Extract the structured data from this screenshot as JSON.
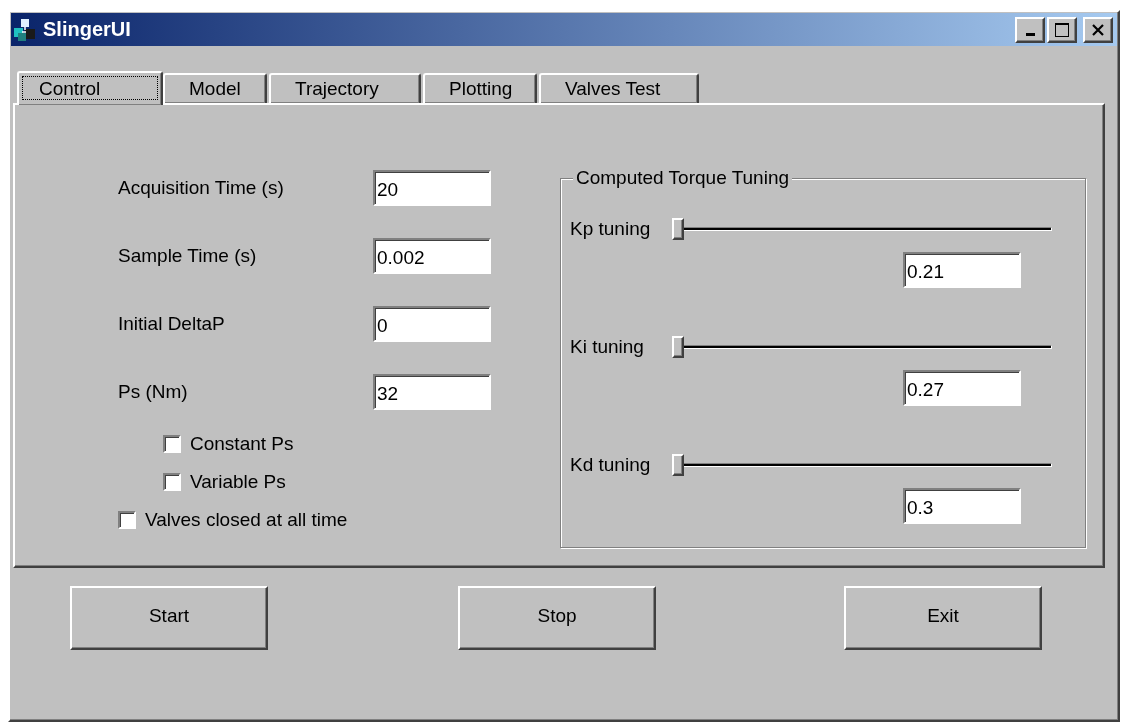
{
  "window": {
    "title": "SlingerUI",
    "controls": [
      {
        "kind": "minimize"
      },
      {
        "kind": "maximize"
      },
      {
        "kind": "close"
      }
    ]
  },
  "tabs": [
    {
      "label": "Control",
      "selected": true
    },
    {
      "label": "Model",
      "selected": false
    },
    {
      "label": "Trajectory",
      "selected": false
    },
    {
      "label": "Plotting",
      "selected": false
    },
    {
      "label": "Valves Test",
      "selected": false
    }
  ],
  "fields": [
    {
      "label": "Acquisition Time (s)",
      "value": "20"
    },
    {
      "label": "Sample Time (s)",
      "value": "0.002"
    },
    {
      "label": "Initial DeltaP",
      "value": "0"
    },
    {
      "label": "Ps (Nm)",
      "value": "32"
    }
  ],
  "ps_options": [
    {
      "label": "Constant Ps",
      "checked": false
    },
    {
      "label": "Variable Ps",
      "checked": false
    }
  ],
  "valves_closed": {
    "label": "Valves closed at all time",
    "checked": false
  },
  "tuning": {
    "title": "Computed Torque Tuning",
    "sliders": [
      {
        "label": "Kp tuning",
        "level": 0,
        "value": "0.21"
      },
      {
        "label": "Ki tuning",
        "level": 0,
        "value": "0.27"
      },
      {
        "label": "Kd tuning",
        "level": 0,
        "value": "0.3"
      }
    ]
  },
  "buttons": [
    "Start",
    "Stop",
    "Exit"
  ]
}
